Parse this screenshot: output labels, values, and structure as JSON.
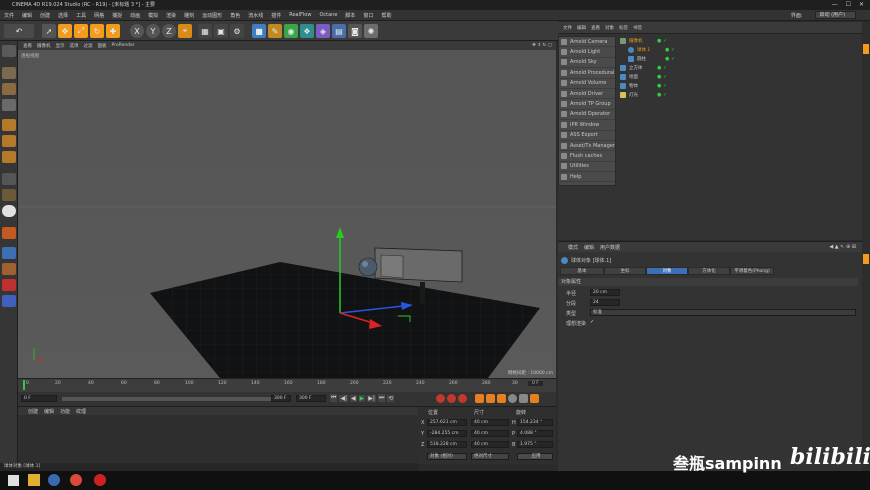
{
  "window": {
    "title": "CINEMA 4D R19.024 Studio (RC - R19) - [未标题 3 *] - 主要"
  },
  "menu": {
    "items": [
      "文件",
      "编辑",
      "创建",
      "选择",
      "工具",
      "网格",
      "捕捉",
      "动画",
      "模拟",
      "渲染",
      "雕刻",
      "运动图形",
      "角色",
      "流水线",
      "插件",
      "RealFlow",
      "Octane",
      "脚本",
      "窗口",
      "帮助"
    ],
    "layout_label": "界面:",
    "layout_value": "启动 (用户)"
  },
  "viewport": {
    "header_items": [
      "查看",
      "摄像机",
      "显示",
      "选项",
      "过滤",
      "面板",
      "ProRender"
    ],
    "view_label": "透视视图",
    "grid_label": "网格间距 : 10000 cm"
  },
  "timeline": {
    "ticks": [
      "0",
      "20",
      "40",
      "60",
      "80",
      "100",
      "120",
      "140",
      "160",
      "180",
      "200",
      "220",
      "240",
      "260",
      "280",
      "30"
    ],
    "current_frame": "0 F",
    "start": "0 F",
    "end": "300 F",
    "end2": "300 F"
  },
  "material": {
    "menu": [
      "创建",
      "编辑",
      "功能",
      "纹理"
    ]
  },
  "coordinates": {
    "headers": [
      "位置",
      "尺寸",
      "旋转"
    ],
    "rows": [
      {
        "axis": "X",
        "pos": "257.621 cm",
        "size": "40 cm",
        "rot_axis": "H",
        "rot": "154.234 °"
      },
      {
        "axis": "Y",
        "pos": "-284.255 cm",
        "size": "40 cm",
        "rot_axis": "P",
        "rot": "4.088 °"
      },
      {
        "axis": "Z",
        "pos": "518.228 cm",
        "size": "40 cm",
        "rot_axis": "B",
        "rot": "1.975 °"
      }
    ],
    "mode": "对象 (相对)",
    "size_mode": "绝对尺寸",
    "apply": "应用"
  },
  "plugin_menu": [
    "Arnold Camera",
    "Arnold Light",
    "Arnold Sky",
    "Arnold Procedural",
    "Arnold Volume",
    "Arnold Driver",
    "Arnold TP Group",
    "Arnold Operator",
    "IPR Window",
    "ASS Export",
    "Asset/Tx Manager",
    "Flush caches",
    "Utilities",
    "Help"
  ],
  "object_manager": {
    "tabs": [
      "文件",
      "编辑",
      "查看",
      "对象",
      "标签",
      "书签"
    ],
    "objects": [
      "摄像机",
      "球体.1",
      "圆柱",
      "立方体",
      "地面",
      "物体",
      "灯光"
    ]
  },
  "attribute_manager": {
    "tabs": [
      "模式",
      "编辑",
      "用户数据"
    ],
    "object_title": "球体对象 [球体.1]",
    "sub_tabs": [
      "基本",
      "坐标",
      "对象",
      "平滑着色(Phong)",
      "方体化"
    ],
    "active_tab": "对象",
    "section": "对象属性",
    "fields": [
      {
        "label": "半径",
        "value": "20 cm"
      },
      {
        "label": "分段",
        "value": "24"
      },
      {
        "label": "类型",
        "value": "标准"
      },
      {
        "label": "理想渲染",
        "value": "✓"
      }
    ]
  },
  "status": {
    "text": "球体对象 [球体.1]"
  },
  "watermark": {
    "text": "叁瓶sampinn",
    "brand": "bilibili"
  },
  "colors": {
    "accent": "#f29b1d",
    "axis_y": "#22cc22",
    "axis_x": "#2a55e0",
    "axis_z": "#dd2222",
    "active_tab": "#3d6fb5"
  }
}
